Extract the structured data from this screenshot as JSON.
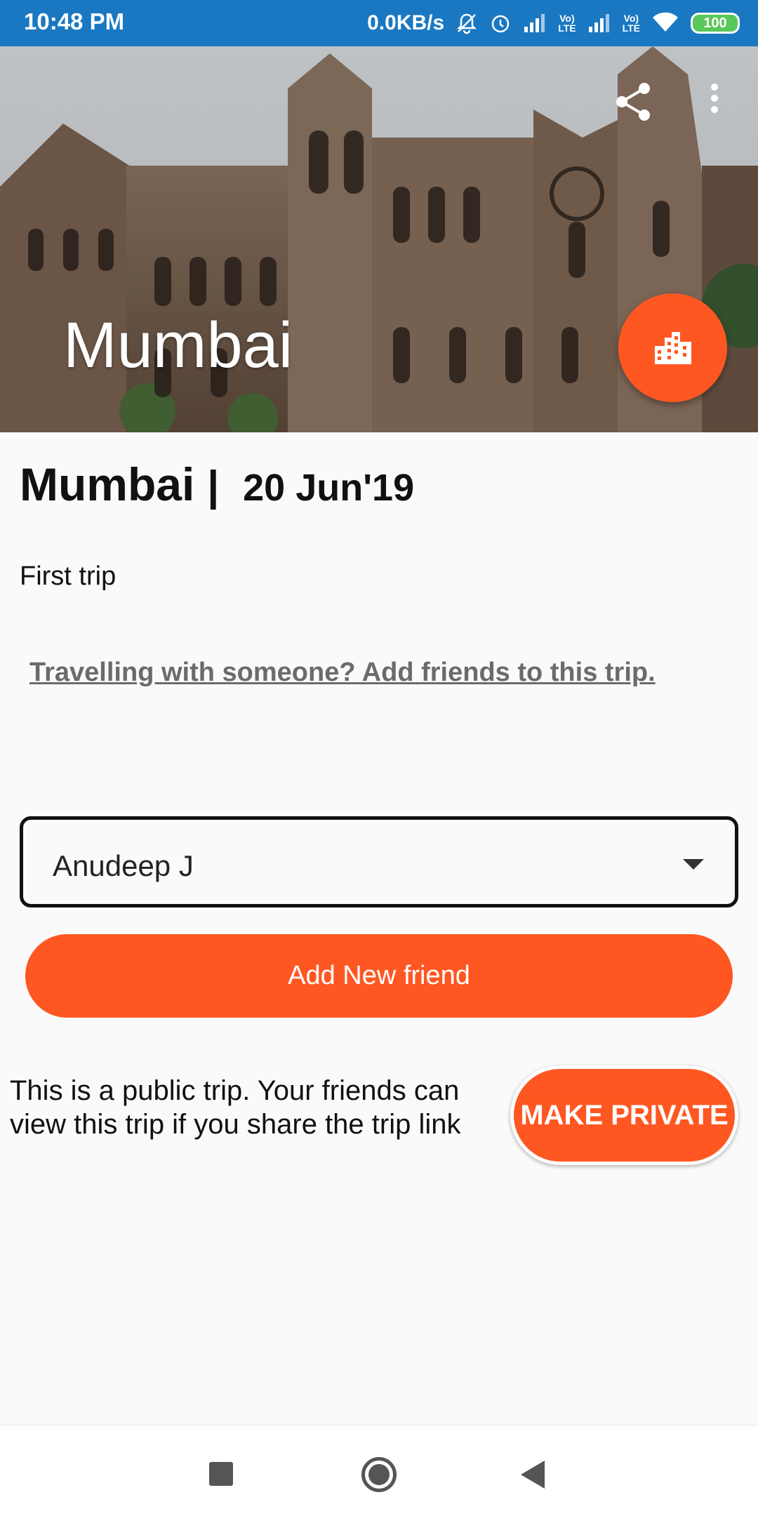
{
  "status_bar": {
    "time": "10:48 PM",
    "net_speed": "0.0KB/s",
    "volte1": "Vo)\nLTE",
    "volte2": "Vo)\nLTE",
    "battery": "100",
    "icons": [
      "mute-bell-icon",
      "alarm-icon",
      "signal-icon",
      "volte-icon",
      "signal-icon",
      "volte-icon",
      "wifi-icon",
      "battery-icon"
    ]
  },
  "hero": {
    "title": "Mumbai",
    "share_icon": "share-icon",
    "more_icon": "more-vert-icon",
    "fab_icon": "city-icon"
  },
  "trip": {
    "city": "Mumbai",
    "separator": "|",
    "date": "20 Jun'19",
    "description": "First trip",
    "add_friends_link": "Travelling with someone? Add friends to this trip."
  },
  "friends": {
    "selected": "Anudeep J",
    "add_button": "Add New friend"
  },
  "privacy": {
    "note": "This is a public trip. Your friends can view this trip if you share the trip link",
    "button": "MAKE PRIVATE"
  },
  "colors": {
    "status_bar": "#1a78c2",
    "accent": "#ff5722",
    "background": "#fafafa"
  },
  "nav": {
    "icons": [
      "recents-icon",
      "home-icon",
      "back-icon"
    ]
  }
}
